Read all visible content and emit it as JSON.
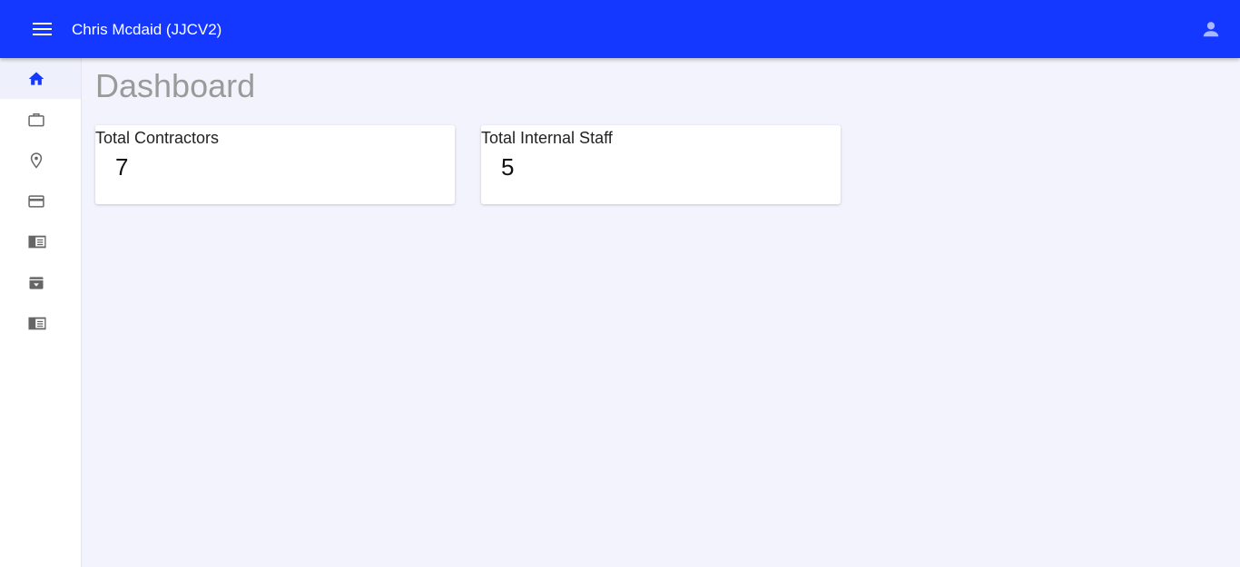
{
  "header": {
    "title": "Chris Mcdaid (JJCV2)",
    "menu_icon": "menu-icon",
    "account_icon": "account-icon",
    "accent_color": "#1438ff"
  },
  "sidebar": {
    "items": [
      {
        "icon": "home-icon",
        "active": true
      },
      {
        "icon": "briefcase-icon",
        "active": false
      },
      {
        "icon": "location-pin-icon",
        "active": false
      },
      {
        "icon": "credit-card-icon",
        "active": false
      },
      {
        "icon": "list-card-icon",
        "active": false
      },
      {
        "icon": "archive-icon",
        "active": false
      },
      {
        "icon": "list-card-icon",
        "active": false
      }
    ]
  },
  "main": {
    "title": "Dashboard",
    "cards": [
      {
        "label": "Total Contractors",
        "value": "7"
      },
      {
        "label": "Total Internal Staff",
        "value": "5"
      }
    ]
  }
}
